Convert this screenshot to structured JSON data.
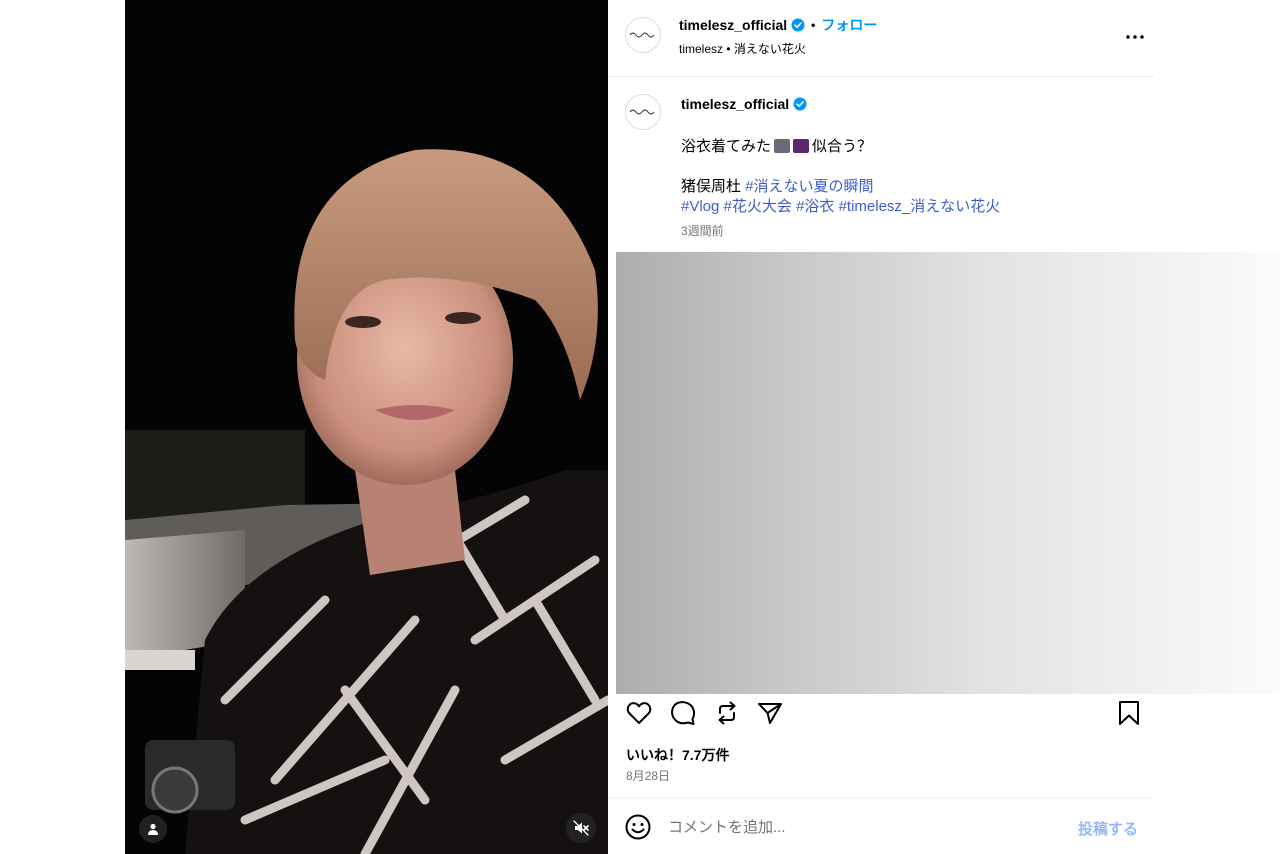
{
  "header": {
    "username": "timelesz_official",
    "follow_label": "フォロー",
    "separator": "•",
    "subtitle": "timelesz • 消えない花火",
    "more_icon": "more-horizontal-icon",
    "verified_icon": "verified-badge-icon"
  },
  "caption": {
    "username": "timelesz_official",
    "line1_text": "浴衣着てみた",
    "line1_suffix": "似合う？",
    "line1_emojis": [
      "camera-emoji",
      "fireworks-emoji"
    ],
    "line2_name": "猪俣周杜",
    "line2_tags": [
      "#消えない夏の瞬間"
    ],
    "line3_tags": [
      "#Vlog",
      "#花火大会",
      "#浴衣",
      "#timelesz_消えない花火"
    ],
    "time": "3週間前"
  },
  "actions": {
    "icons": [
      "heart-icon",
      "comment-icon",
      "repost-icon",
      "share-icon",
      "bookmark-icon"
    ]
  },
  "likes": "いいね！7.7万件",
  "date": "8月28日",
  "comment": {
    "placeholder": "コメントを追加...",
    "post_label": "投稿する"
  },
  "media": {
    "tag_icon": "user-tag-icon",
    "mute_icon": "speaker-muted-icon"
  },
  "colors": {
    "accent": "#0095f6",
    "hashtag": "#3d5ccc",
    "secondary_text": "#737373",
    "post_disabled": "#93b8f4"
  }
}
